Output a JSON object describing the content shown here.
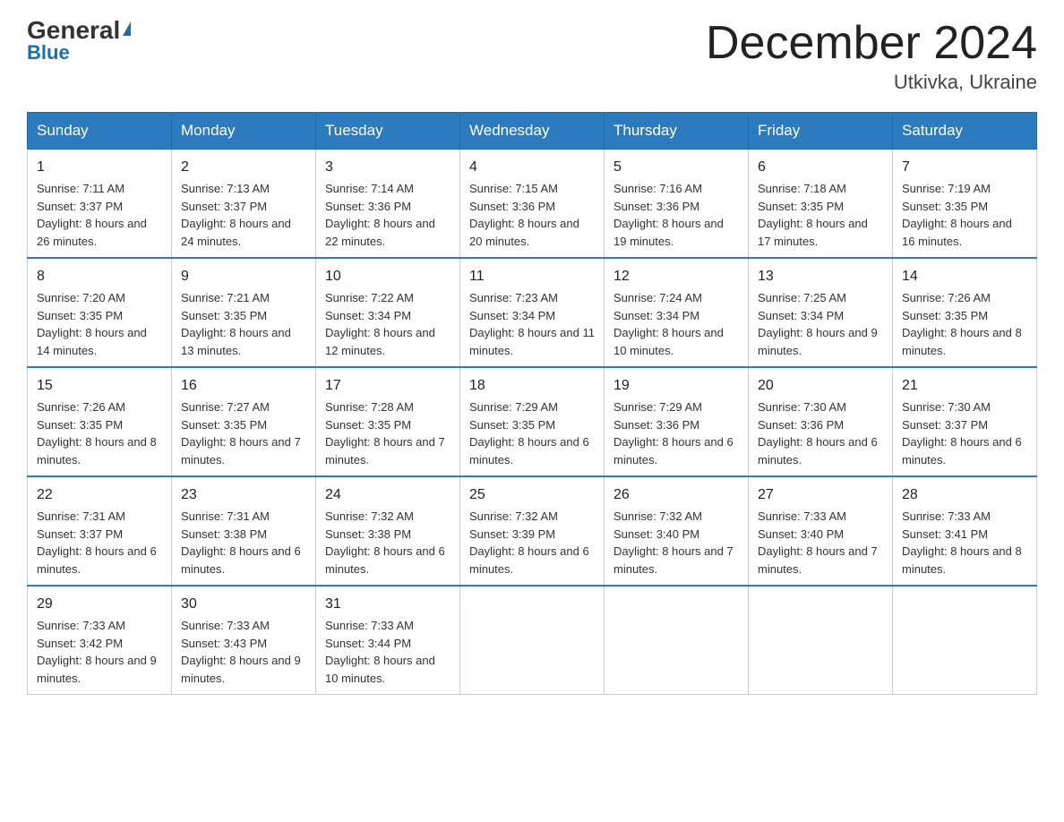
{
  "header": {
    "logo_general": "General",
    "logo_blue": "Blue",
    "month_title": "December 2024",
    "location": "Utkivka, Ukraine"
  },
  "days_of_week": [
    "Sunday",
    "Monday",
    "Tuesday",
    "Wednesday",
    "Thursday",
    "Friday",
    "Saturday"
  ],
  "weeks": [
    [
      {
        "day": "1",
        "sunrise": "7:11 AM",
        "sunset": "3:37 PM",
        "daylight": "8 hours and 26 minutes."
      },
      {
        "day": "2",
        "sunrise": "7:13 AM",
        "sunset": "3:37 PM",
        "daylight": "8 hours and 24 minutes."
      },
      {
        "day": "3",
        "sunrise": "7:14 AM",
        "sunset": "3:36 PM",
        "daylight": "8 hours and 22 minutes."
      },
      {
        "day": "4",
        "sunrise": "7:15 AM",
        "sunset": "3:36 PM",
        "daylight": "8 hours and 20 minutes."
      },
      {
        "day": "5",
        "sunrise": "7:16 AM",
        "sunset": "3:36 PM",
        "daylight": "8 hours and 19 minutes."
      },
      {
        "day": "6",
        "sunrise": "7:18 AM",
        "sunset": "3:35 PM",
        "daylight": "8 hours and 17 minutes."
      },
      {
        "day": "7",
        "sunrise": "7:19 AM",
        "sunset": "3:35 PM",
        "daylight": "8 hours and 16 minutes."
      }
    ],
    [
      {
        "day": "8",
        "sunrise": "7:20 AM",
        "sunset": "3:35 PM",
        "daylight": "8 hours and 14 minutes."
      },
      {
        "day": "9",
        "sunrise": "7:21 AM",
        "sunset": "3:35 PM",
        "daylight": "8 hours and 13 minutes."
      },
      {
        "day": "10",
        "sunrise": "7:22 AM",
        "sunset": "3:34 PM",
        "daylight": "8 hours and 12 minutes."
      },
      {
        "day": "11",
        "sunrise": "7:23 AM",
        "sunset": "3:34 PM",
        "daylight": "8 hours and 11 minutes."
      },
      {
        "day": "12",
        "sunrise": "7:24 AM",
        "sunset": "3:34 PM",
        "daylight": "8 hours and 10 minutes."
      },
      {
        "day": "13",
        "sunrise": "7:25 AM",
        "sunset": "3:34 PM",
        "daylight": "8 hours and 9 minutes."
      },
      {
        "day": "14",
        "sunrise": "7:26 AM",
        "sunset": "3:35 PM",
        "daylight": "8 hours and 8 minutes."
      }
    ],
    [
      {
        "day": "15",
        "sunrise": "7:26 AM",
        "sunset": "3:35 PM",
        "daylight": "8 hours and 8 minutes."
      },
      {
        "day": "16",
        "sunrise": "7:27 AM",
        "sunset": "3:35 PM",
        "daylight": "8 hours and 7 minutes."
      },
      {
        "day": "17",
        "sunrise": "7:28 AM",
        "sunset": "3:35 PM",
        "daylight": "8 hours and 7 minutes."
      },
      {
        "day": "18",
        "sunrise": "7:29 AM",
        "sunset": "3:35 PM",
        "daylight": "8 hours and 6 minutes."
      },
      {
        "day": "19",
        "sunrise": "7:29 AM",
        "sunset": "3:36 PM",
        "daylight": "8 hours and 6 minutes."
      },
      {
        "day": "20",
        "sunrise": "7:30 AM",
        "sunset": "3:36 PM",
        "daylight": "8 hours and 6 minutes."
      },
      {
        "day": "21",
        "sunrise": "7:30 AM",
        "sunset": "3:37 PM",
        "daylight": "8 hours and 6 minutes."
      }
    ],
    [
      {
        "day": "22",
        "sunrise": "7:31 AM",
        "sunset": "3:37 PM",
        "daylight": "8 hours and 6 minutes."
      },
      {
        "day": "23",
        "sunrise": "7:31 AM",
        "sunset": "3:38 PM",
        "daylight": "8 hours and 6 minutes."
      },
      {
        "day": "24",
        "sunrise": "7:32 AM",
        "sunset": "3:38 PM",
        "daylight": "8 hours and 6 minutes."
      },
      {
        "day": "25",
        "sunrise": "7:32 AM",
        "sunset": "3:39 PM",
        "daylight": "8 hours and 6 minutes."
      },
      {
        "day": "26",
        "sunrise": "7:32 AM",
        "sunset": "3:40 PM",
        "daylight": "8 hours and 7 minutes."
      },
      {
        "day": "27",
        "sunrise": "7:33 AM",
        "sunset": "3:40 PM",
        "daylight": "8 hours and 7 minutes."
      },
      {
        "day": "28",
        "sunrise": "7:33 AM",
        "sunset": "3:41 PM",
        "daylight": "8 hours and 8 minutes."
      }
    ],
    [
      {
        "day": "29",
        "sunrise": "7:33 AM",
        "sunset": "3:42 PM",
        "daylight": "8 hours and 9 minutes."
      },
      {
        "day": "30",
        "sunrise": "7:33 AM",
        "sunset": "3:43 PM",
        "daylight": "8 hours and 9 minutes."
      },
      {
        "day": "31",
        "sunrise": "7:33 AM",
        "sunset": "3:44 PM",
        "daylight": "8 hours and 10 minutes."
      },
      null,
      null,
      null,
      null
    ]
  ]
}
